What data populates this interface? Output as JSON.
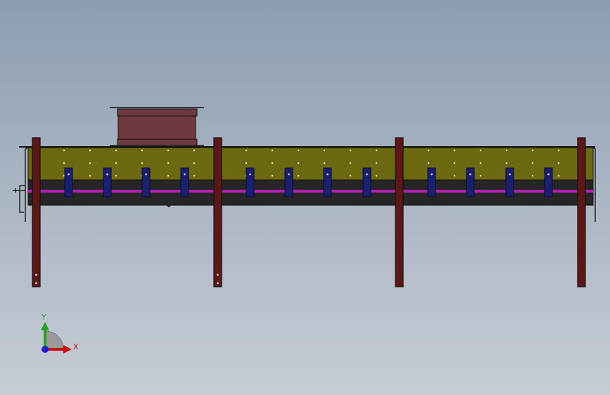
{
  "colors": {
    "panel_olive": "#6b6a10",
    "panel_band_dark": "#262626",
    "magenta_stripe": "#b41fb4",
    "leg_maroon": "#5e1717",
    "box_brown": "#6e3a3f",
    "clip_navy": "#1a1f6e",
    "outline": "#111111",
    "axis_x": "#c21616",
    "axis_y": "#23a323",
    "axis_z": "#2222cc"
  },
  "triad": {
    "x_label": "X",
    "y_label": "Y"
  }
}
